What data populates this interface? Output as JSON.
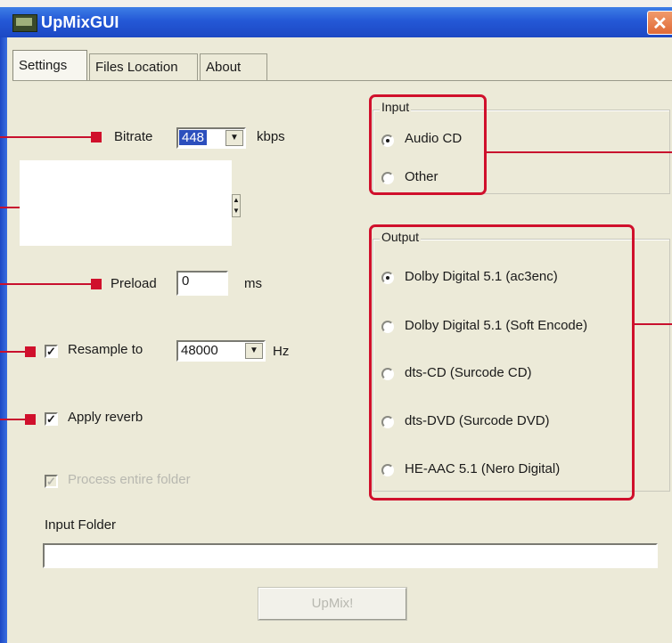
{
  "window": {
    "title": "UpMixGUI",
    "close_glyph": "✕"
  },
  "tabs": [
    "Settings",
    "Files Location",
    "About"
  ],
  "settings": {
    "bitrate": {
      "label": "Bitrate",
      "value": "448",
      "unit": "kbps"
    },
    "preload": {
      "label": "Preload",
      "value": "0",
      "unit": "ms"
    },
    "resample": {
      "label": "Resample to",
      "value": "48000",
      "unit": "Hz",
      "checked": true
    },
    "apply_reverb": {
      "label": "Apply reverb",
      "checked": true
    },
    "process_folder": {
      "label": "Process entire folder",
      "checked": true,
      "disabled": true
    },
    "input_folder": {
      "label": "Input Folder",
      "value": ""
    },
    "upmix_button": "UpMix!"
  },
  "input_group": {
    "title": "Input",
    "options": [
      "Audio CD",
      "Other"
    ],
    "selected": 0
  },
  "output_group": {
    "title": "Output",
    "options": [
      "Dolby Digital 5.1 (ac3enc)",
      "Dolby Digital 5.1 (Soft Encode)",
      "dts-CD (Surcode CD)",
      "dts-DVD (Surcode DVD)",
      "HE-AAC 5.1 (Nero Digital)"
    ],
    "selected": 0
  },
  "check_glyph": "✓",
  "dropdown_glyph": "▼",
  "spin_glyphs": {
    "up": "▲",
    "down": "▼"
  },
  "colors": {
    "annotation": "#d0102c",
    "titlebar": "#2458d6",
    "selection": "#2c4fbd"
  }
}
